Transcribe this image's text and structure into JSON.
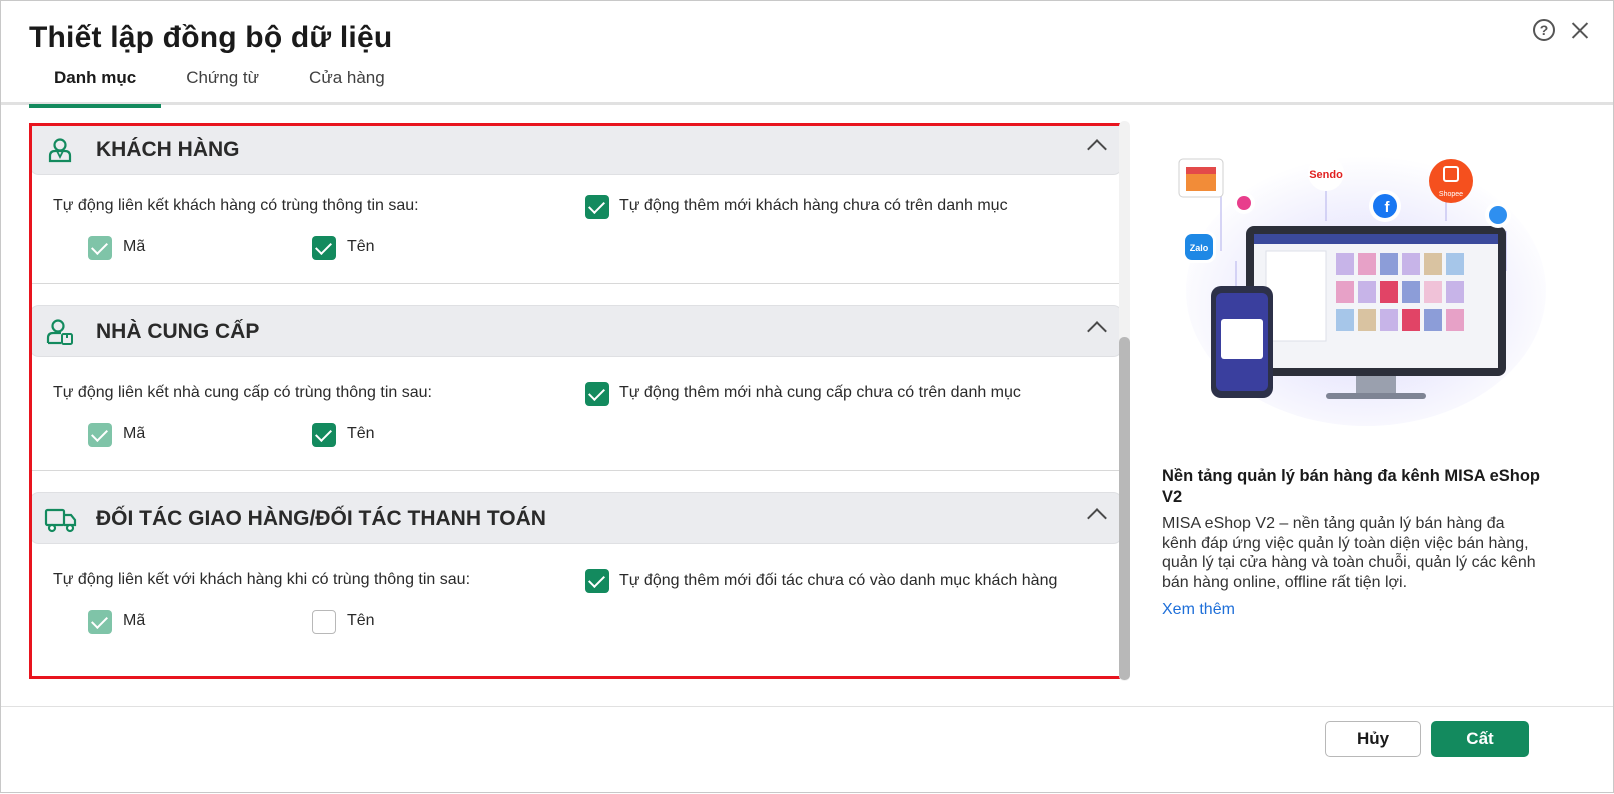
{
  "dialog": {
    "title": "Thiết lập đồng bộ dữ liệu",
    "tabs": [
      {
        "label": "Danh mục",
        "active": true
      },
      {
        "label": "Chứng từ",
        "active": false
      },
      {
        "label": "Cửa hàng",
        "active": false
      }
    ]
  },
  "sections": [
    {
      "title": "KHÁCH HÀNG",
      "icon": "customer-icon",
      "link_label": "Tự động liên kết khách hàng có trùng thông tin sau:",
      "code_label": "Mã",
      "code_state": "checked-disabled",
      "name_label": "Tên",
      "name_state": "checked",
      "auto_add_label": "Tự động thêm mới khách hàng chưa có trên danh mục",
      "auto_add_state": "checked"
    },
    {
      "title": "NHÀ CUNG CẤP",
      "icon": "supplier-icon",
      "link_label": "Tự động liên kết nhà cung cấp có trùng thông tin sau:",
      "code_label": "Mã",
      "code_state": "checked-disabled",
      "name_label": "Tên",
      "name_state": "checked",
      "auto_add_label": "Tự động thêm mới nhà cung cấp chưa có trên danh mục",
      "auto_add_state": "checked"
    },
    {
      "title": "ĐỐI TÁC GIAO HÀNG/ĐỐI TÁC THANH TOÁN",
      "icon": "delivery-truck-icon",
      "link_label": "Tự động liên kết với khách hàng khi có trùng thông tin sau:",
      "code_label": "Mã",
      "code_state": "checked-disabled",
      "name_label": "Tên",
      "name_state": "unchecked",
      "auto_add_label": "Tự động thêm mới đối tác chưa có vào danh mục khách hàng",
      "auto_add_state": "checked"
    }
  ],
  "promo": {
    "title": "Nền tảng quản lý bán hàng đa kênh MISA eShop V2",
    "description": "MISA eShop V2 – nền tảng quản lý bán hàng đa kênh đáp ứng việc quản lý toàn diện việc bán hàng, quản lý tại cửa hàng và toàn chuỗi, quản lý các kênh bán hàng online, offline rất tiện lợi.",
    "link": "Xem thêm",
    "badges": {
      "sendo": "Sendo",
      "shopee": "Shopee",
      "zalo": "Zalo"
    }
  },
  "footer": {
    "cancel_label": "Hủy",
    "save_label": "Cất"
  },
  "colors": {
    "accent": "#138a5e",
    "highlight_border": "#e8141e",
    "link": "#1e6fd9"
  }
}
